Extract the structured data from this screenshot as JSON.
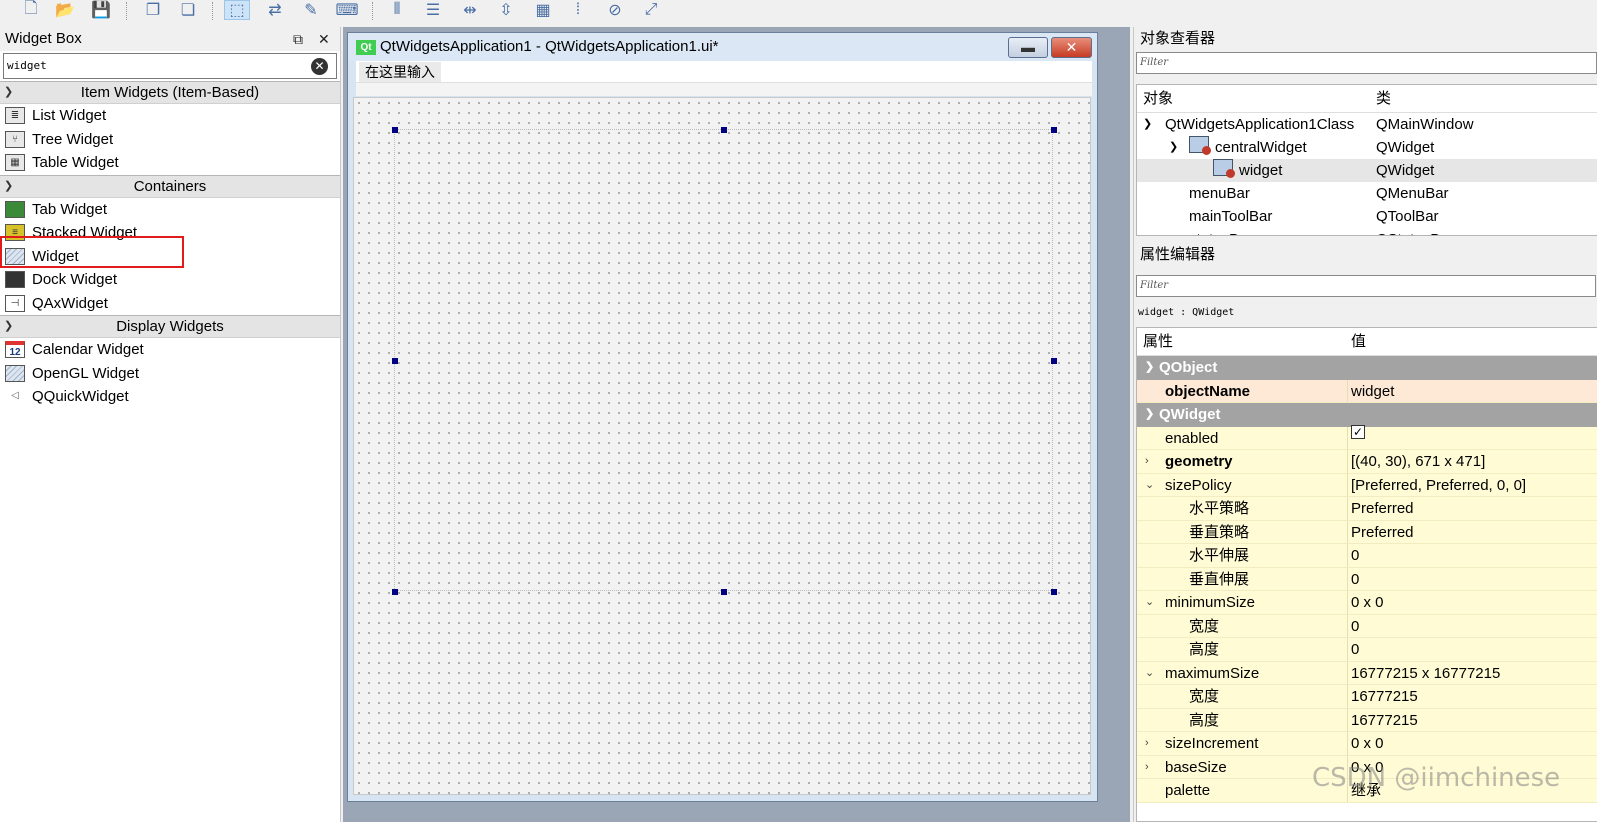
{
  "toolbar": {
    "icons": [
      "new-file-icon",
      "open-folder-icon",
      "save-icon",
      "copy-icon",
      "paste-icon",
      "widget-edit-icon",
      "signal-slot-icon",
      "buddy-icon",
      "tab-order-icon",
      "layout-horizontal-icon",
      "layout-vertical-icon",
      "split-horizontal-icon",
      "split-vertical-icon",
      "grid-layout-icon",
      "form-layout-icon",
      "break-layout-icon",
      "adjust-size-icon"
    ]
  },
  "widget_box": {
    "title": "Widget Box",
    "float_glyph": "⧉",
    "close_glyph": "✕",
    "filter_value": "widget",
    "categories": [
      {
        "label": "Item Widgets (Item-Based)",
        "items": [
          {
            "label": "List Widget",
            "icon": "list-widget-icon"
          },
          {
            "label": "Tree Widget",
            "icon": "tree-widget-icon"
          },
          {
            "label": "Table Widget",
            "icon": "table-widget-icon"
          }
        ]
      },
      {
        "label": "Containers",
        "items": [
          {
            "label": "Tab Widget",
            "icon": "tab-widget-icon"
          },
          {
            "label": "Stacked Widget",
            "icon": "stacked-widget-icon"
          },
          {
            "label": "Widget",
            "icon": "widget-icon"
          },
          {
            "label": "Dock Widget",
            "icon": "dock-widget-icon"
          },
          {
            "label": "QAxWidget",
            "icon": "qaxwidget-icon"
          }
        ]
      },
      {
        "label": "Display Widgets",
        "items": [
          {
            "label": "Calendar Widget",
            "icon": "calendar-widget-icon",
            "glyph": "12"
          },
          {
            "label": "OpenGL Widget",
            "icon": "opengl-widget-icon"
          },
          {
            "label": "QQuickWidget",
            "icon": "qquickwidget-icon"
          }
        ]
      }
    ]
  },
  "form": {
    "logo": "Qt",
    "title": "QtWidgetsApplication1 - QtWidgetsApplication1.ui*",
    "menu_placeholder": "在这里输入",
    "minimize_glyph": "▬",
    "close_glyph": "✕"
  },
  "object_inspector": {
    "title": "对象查看器",
    "filter_placeholder": "Filter",
    "col_object": "对象",
    "col_class": "类",
    "rows": [
      {
        "name": "QtWidgetsApplication1Class",
        "cls": "QMainWindow"
      },
      {
        "name": "centralWidget",
        "cls": "QWidget"
      },
      {
        "name": "widget",
        "cls": "QWidget"
      },
      {
        "name": "menuBar",
        "cls": "QMenuBar"
      },
      {
        "name": "mainToolBar",
        "cls": "QToolBar"
      },
      {
        "name": "statusBar",
        "cls": "QStatusBar"
      }
    ]
  },
  "property_editor": {
    "title": "属性编辑器",
    "filter_placeholder": "Filter",
    "context": "widget : QWidget",
    "col_property": "属性",
    "col_value": "值",
    "group_qobject": "QObject",
    "group_qwidget": "QWidget",
    "objectName": {
      "name": "objectName",
      "value": "widget"
    },
    "enabled": {
      "name": "enabled",
      "checked": true,
      "check_glyph": "✓"
    },
    "geometry": {
      "name": "geometry",
      "value": "[(40, 30), 671 x 471]"
    },
    "sizePolicy": {
      "name": "sizePolicy",
      "value": "[Preferred, Preferred, 0, 0]"
    },
    "hpolicy": {
      "name": "水平策略",
      "value": "Preferred"
    },
    "vpolicy": {
      "name": "垂直策略",
      "value": "Preferred"
    },
    "hstretch": {
      "name": "水平伸展",
      "value": "0"
    },
    "vstretch": {
      "name": "垂直伸展",
      "value": "0"
    },
    "minimumSize": {
      "name": "minimumSize",
      "value": "0 x 0"
    },
    "min_w": {
      "name": "宽度",
      "value": "0"
    },
    "min_h": {
      "name": "高度",
      "value": "0"
    },
    "maximumSize": {
      "name": "maximumSize",
      "value": "16777215 x 16777215"
    },
    "max_w": {
      "name": "宽度",
      "value": "16777215"
    },
    "max_h": {
      "name": "高度",
      "value": "16777215"
    },
    "sizeIncrement": {
      "name": "sizeIncrement",
      "value": "0 x 0"
    },
    "baseSize": {
      "name": "baseSize",
      "value": "0 x 0"
    },
    "palette": {
      "name": "palette",
      "value": "继承"
    }
  },
  "watermark": "CSDN @iimchinese",
  "colors": {
    "highlight": "#e01b1b",
    "property_bg": "#fefbd5",
    "group_bg": "#a3a3a3",
    "handle": "#000080"
  }
}
